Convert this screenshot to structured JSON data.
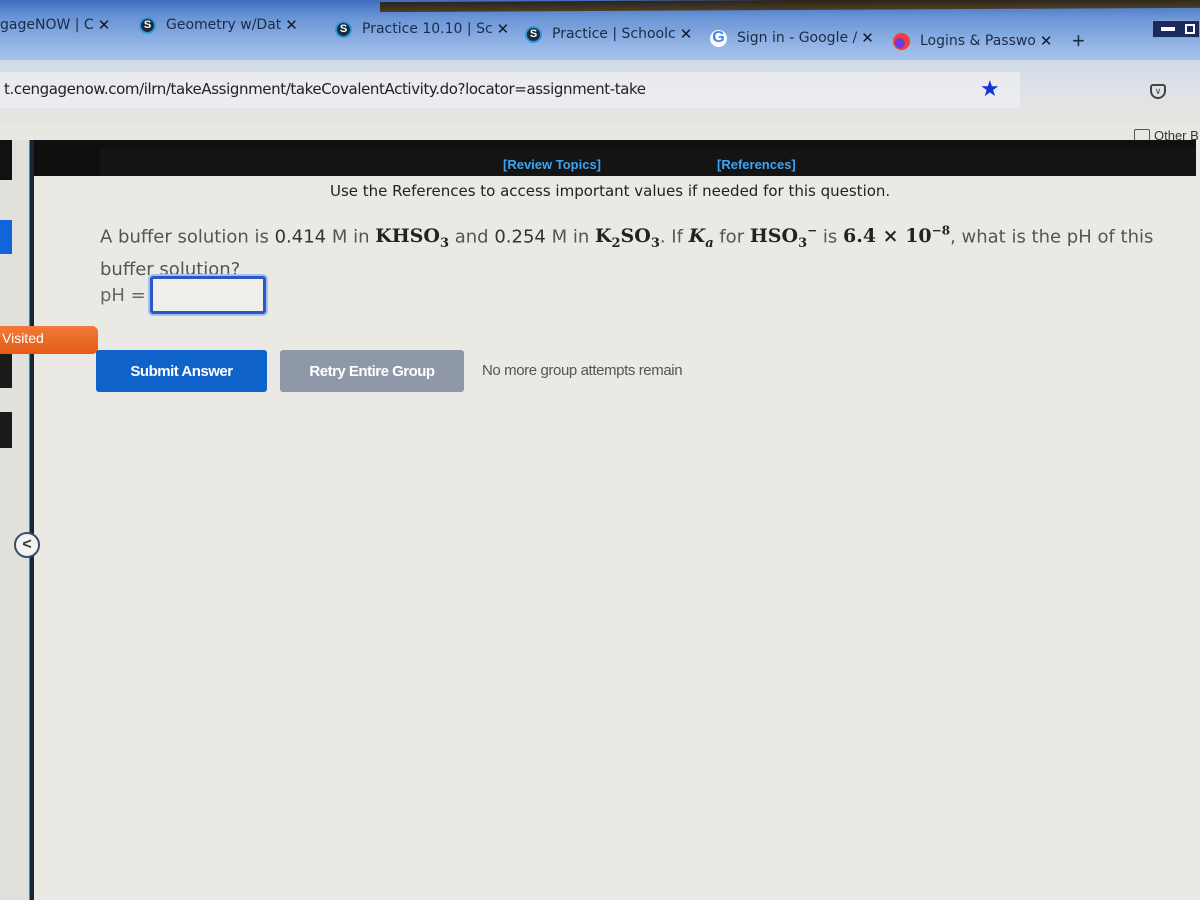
{
  "browser": {
    "tabs": [
      {
        "label": "gageNOW | C",
        "icon": "none"
      },
      {
        "label": "Geometry w/Dat",
        "icon": "schoology-icon"
      },
      {
        "label": "Practice 10.10 | Sc",
        "icon": "schoology-icon"
      },
      {
        "label": "Practice | Schoolc",
        "icon": "schoology-icon"
      },
      {
        "label": "Sign in - Google /",
        "icon": "google-icon"
      },
      {
        "label": "Logins & Passwo",
        "icon": "firefox-icon"
      }
    ],
    "close_glyph": "✕",
    "new_tab_glyph": "+",
    "url": "t.cengagenow.com/ilrn/takeAssignment/takeCovalentActivity.do?locator=assignment-take",
    "bookmark_star": "★",
    "bookmarks_folder": "Other B"
  },
  "sidebar": {
    "visited_label": "Visited",
    "collapse_glyph": "<"
  },
  "page": {
    "links": {
      "review_topics": "[Review Topics]",
      "references": "[References]"
    },
    "reference_note": "Use the References to access important values if needed for this question.",
    "question": {
      "t1": "A buffer solution is ",
      "conc1": "0.414",
      "t2": " M in ",
      "salt1_main": "KHSO",
      "salt1_sub": "3",
      "t3": " and ",
      "conc2": "0.254",
      "t4": " M in ",
      "salt2_a": "K",
      "salt2_sub1": "2",
      "salt2_b": "SO",
      "salt2_sub2": "3",
      "t5": ". If ",
      "ka_k": "K",
      "ka_sub": "a",
      "t6": " for ",
      "acid_main": "HSO",
      "acid_sub": "3",
      "acid_charge": "−",
      "t7": " is ",
      "ka_mantissa": "6.4 × 10",
      "ka_exp": "−8",
      "t8": ", what is the pH of this buffer solution?"
    },
    "answer": {
      "label": "pH =",
      "value": ""
    },
    "buttons": {
      "submit": "Submit Answer",
      "retry": "Retry Entire Group"
    },
    "attempts_note": "No more group attempts remain"
  }
}
